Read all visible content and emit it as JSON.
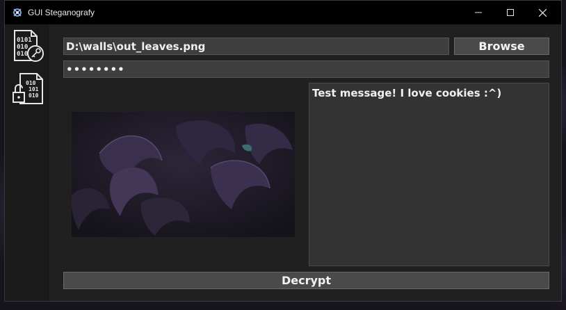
{
  "window": {
    "title": "GUI Steganografy"
  },
  "titlebar": {
    "minimize_icon": "minimize-icon",
    "maximize_icon": "maximize-icon",
    "close_icon": "close-icon"
  },
  "sidebar": {
    "items": [
      {
        "icon": "binary-file-key-icon"
      },
      {
        "icon": "binary-file-unlock-icon"
      }
    ]
  },
  "form": {
    "file_path": "D:\\walls\\out_leaves.png",
    "browse_label": "Browse",
    "password_mask": "••••••••",
    "message": "Test message! I love cookies :^)",
    "decrypt_label": "Decrypt"
  },
  "colors": {
    "titlebar": "#000000",
    "window_bg": "#202020",
    "field_bg": "#3e3e3e",
    "button_bg": "#4a4a4a"
  }
}
